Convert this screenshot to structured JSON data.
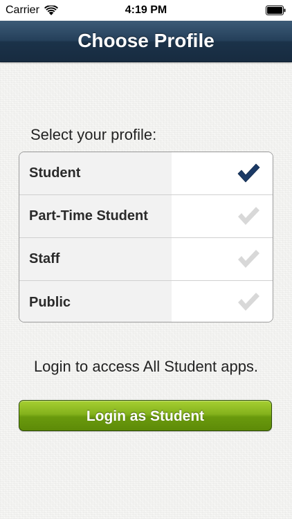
{
  "status_bar": {
    "carrier": "Carrier",
    "time": "4:19 PM",
    "wifi_icon": "wifi-icon",
    "battery_icon": "battery-icon"
  },
  "nav": {
    "title": "Choose Profile"
  },
  "profile_select": {
    "label": "Select your profile:",
    "items": [
      {
        "label": "Student",
        "selected": true
      },
      {
        "label": "Part-Time Student",
        "selected": false
      },
      {
        "label": "Staff",
        "selected": false
      },
      {
        "label": "Public",
        "selected": false
      }
    ]
  },
  "info_text": "Login to access All Student apps.",
  "login_button": {
    "label": "Login as Student"
  },
  "colors": {
    "nav_bar": "#1f3750",
    "check_selected": "#1b3a66",
    "check_unselected": "#d6d6d6",
    "button_green": "#7aa91a"
  }
}
